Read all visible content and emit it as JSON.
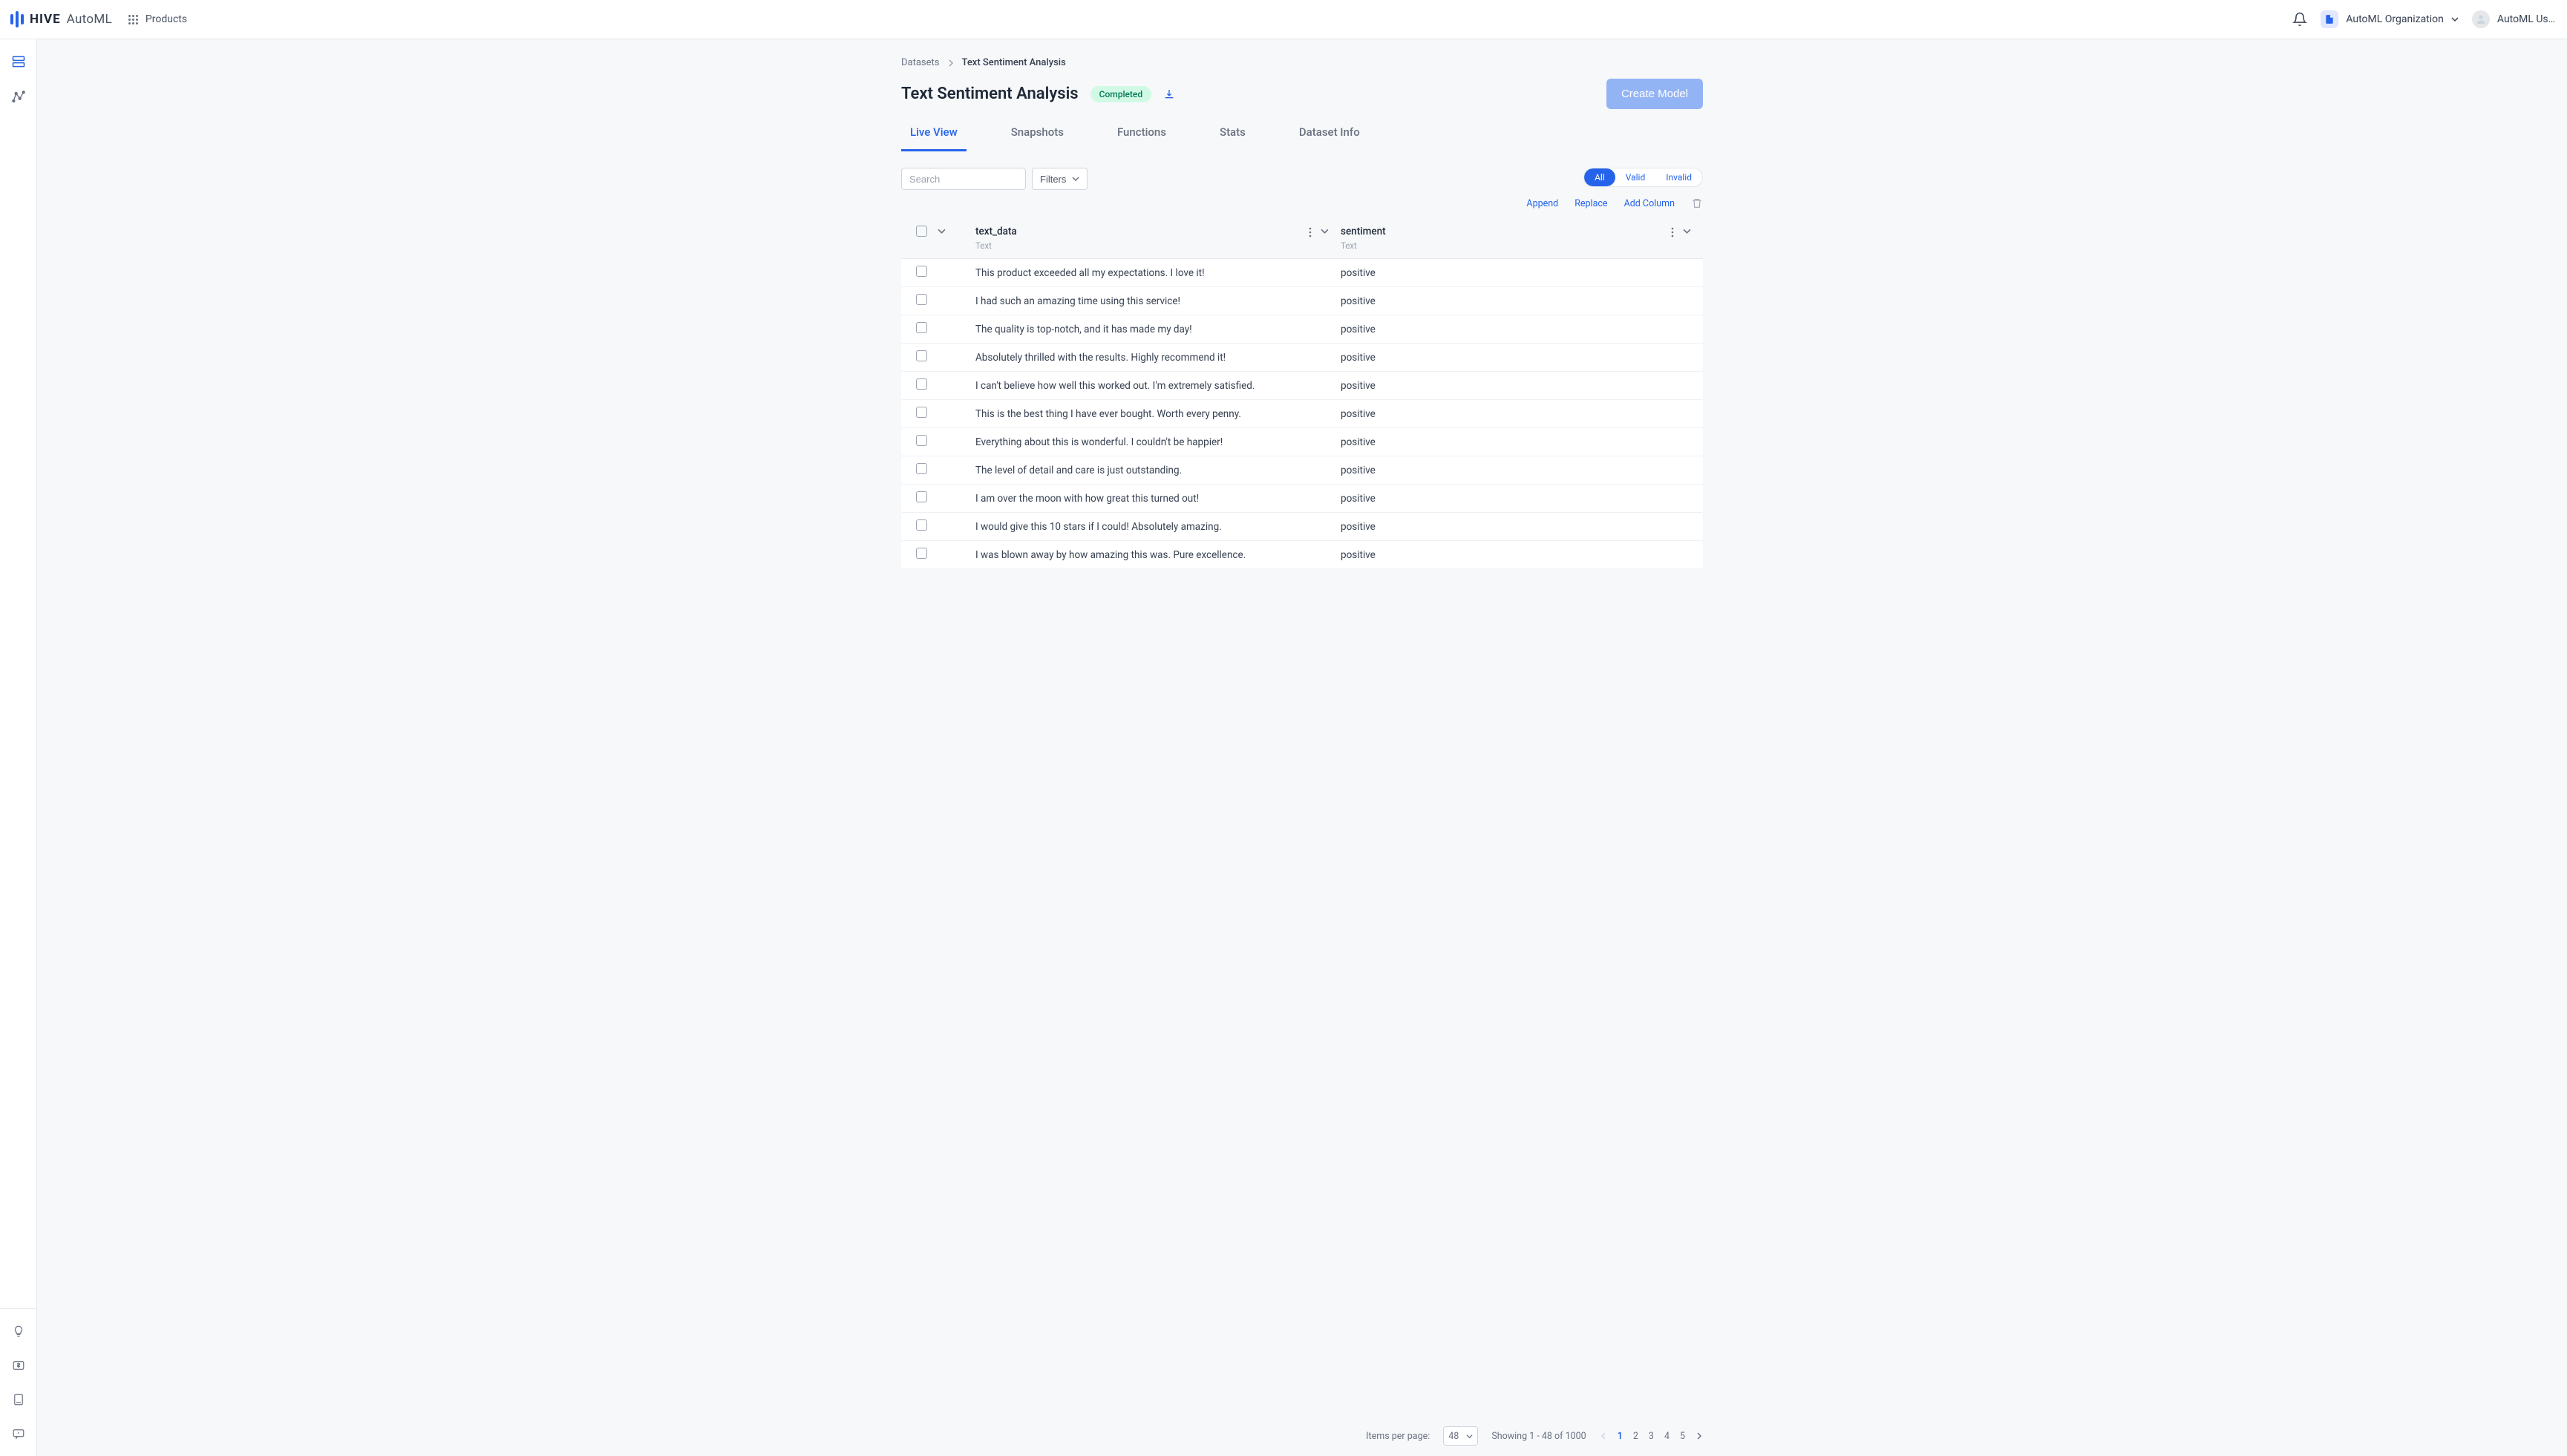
{
  "brand": {
    "name": "HIVE",
    "sub": "AutoML",
    "products_label": "Products"
  },
  "header": {
    "org_name": "AutoML Organization",
    "user_name": "AutoML Us…"
  },
  "breadcrumb": {
    "root": "Datasets",
    "current": "Text Sentiment Analysis"
  },
  "page": {
    "title": "Text Sentiment Analysis",
    "status": "Completed",
    "create_btn": "Create Model"
  },
  "tabs": [
    "Live View",
    "Snapshots",
    "Functions",
    "Stats",
    "Dataset Info"
  ],
  "active_tab": 0,
  "toolbar": {
    "search_placeholder": "Search",
    "filters_label": "Filters",
    "validity": {
      "all": "All",
      "valid": "Valid",
      "invalid": "Invalid"
    },
    "actions": {
      "append": "Append",
      "replace": "Replace",
      "add_column": "Add Column"
    }
  },
  "columns": [
    {
      "name": "text_data",
      "type": "Text"
    },
    {
      "name": "sentiment",
      "type": "Text"
    }
  ],
  "rows": [
    {
      "text": "This product exceeded all my expectations. I love it!",
      "sentiment": "positive"
    },
    {
      "text": "I had such an amazing time using this service!",
      "sentiment": "positive"
    },
    {
      "text": "The quality is top-notch, and it has made my day!",
      "sentiment": "positive"
    },
    {
      "text": "Absolutely thrilled with the results. Highly recommend it!",
      "sentiment": "positive"
    },
    {
      "text": "I can't believe how well this worked out. I'm extremely satisfied.",
      "sentiment": "positive"
    },
    {
      "text": "This is the best thing I have ever bought. Worth every penny.",
      "sentiment": "positive"
    },
    {
      "text": "Everything about this is wonderful. I couldn't be happier!",
      "sentiment": "positive"
    },
    {
      "text": "The level of detail and care is just outstanding.",
      "sentiment": "positive"
    },
    {
      "text": "I am over the moon with how great this turned out!",
      "sentiment": "positive"
    },
    {
      "text": "I would give this 10 stars if I could! Absolutely amazing.",
      "sentiment": "positive"
    },
    {
      "text": "I was blown away by how amazing this was. Pure excellence.",
      "sentiment": "positive"
    }
  ],
  "pagination": {
    "items_per_page_label": "Items per page:",
    "items_per_page_value": "48",
    "showing": "Showing 1 - 48 of 1000",
    "pages": [
      "1",
      "2",
      "3",
      "4",
      "5"
    ],
    "active_page": 0
  }
}
